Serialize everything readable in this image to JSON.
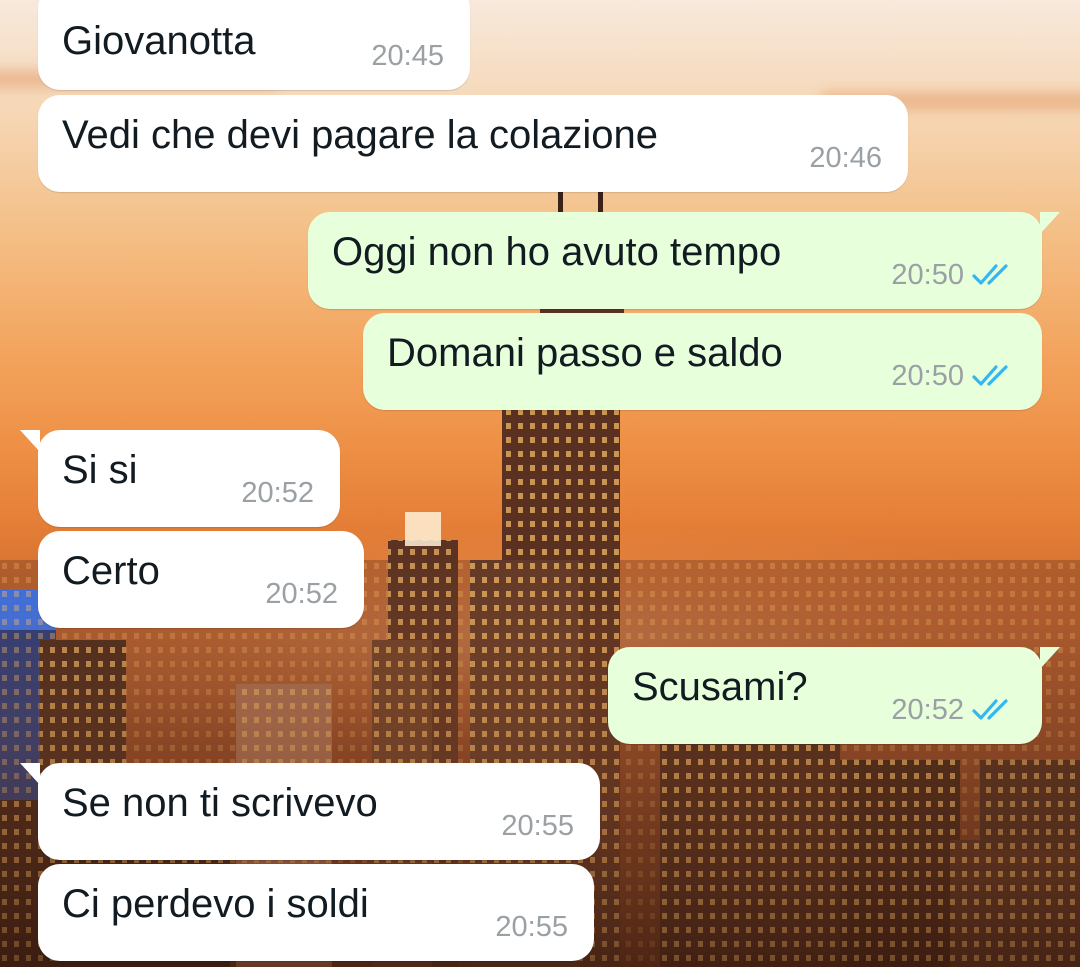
{
  "chat": {
    "messages": [
      {
        "direction": "in",
        "text": "Giovanotta",
        "time": "20:45"
      },
      {
        "direction": "in",
        "text": "Vedi che devi pagare la colazione",
        "time": "20:46"
      },
      {
        "direction": "out",
        "text": "Oggi non ho avuto tempo",
        "time": "20:50",
        "status_icon": "double-check-read-icon"
      },
      {
        "direction": "out",
        "text": "Domani passo e saldo",
        "time": "20:50",
        "status_icon": "double-check-read-icon"
      },
      {
        "direction": "in",
        "text": "Si si",
        "time": "20:52"
      },
      {
        "direction": "in",
        "text": "Certo",
        "time": "20:52"
      },
      {
        "direction": "out",
        "text": "Scusami?",
        "time": "20:52",
        "status_icon": "double-check-read-icon"
      },
      {
        "direction": "in",
        "text": "Se non ti scrivevo",
        "time": "20:55"
      },
      {
        "direction": "in",
        "text": "Ci perdevo i soldi",
        "time": "20:55"
      }
    ]
  },
  "colors": {
    "incoming_bubble": "#ffffff",
    "outgoing_bubble": "#e7ffdb",
    "read_check": "#34b7f1",
    "timestamp": "#9aa0a4"
  }
}
